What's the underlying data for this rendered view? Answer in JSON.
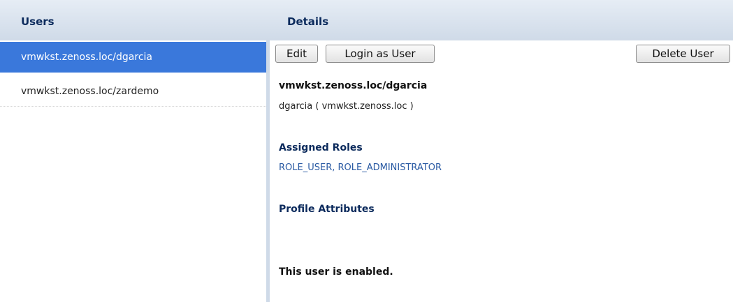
{
  "header": {
    "users_title": "Users",
    "details_title": "Details"
  },
  "users": {
    "items": [
      {
        "label": "vmwkst.zenoss.loc/dgarcia",
        "selected": true
      },
      {
        "label": "vmwkst.zenoss.loc/zardemo",
        "selected": false
      }
    ]
  },
  "details": {
    "buttons": {
      "edit": "Edit",
      "login_as_user": "Login as User",
      "delete_user": "Delete User"
    },
    "user_id": "vmwkst.zenoss.loc/dgarcia",
    "user_sub": "dgarcia ( vmwkst.zenoss.loc )",
    "assigned_roles_label": "Assigned Roles",
    "assigned_roles_value": "ROLE_USER, ROLE_ADMINISTRATOR",
    "profile_attributes_label": "Profile Attributes",
    "status_text": "This user is enabled."
  },
  "colors": {
    "header_bg": "#cfdae8",
    "selected_bg": "#3a78db",
    "heading_text": "#0b2a5c",
    "link_text": "#2a5aa3"
  }
}
